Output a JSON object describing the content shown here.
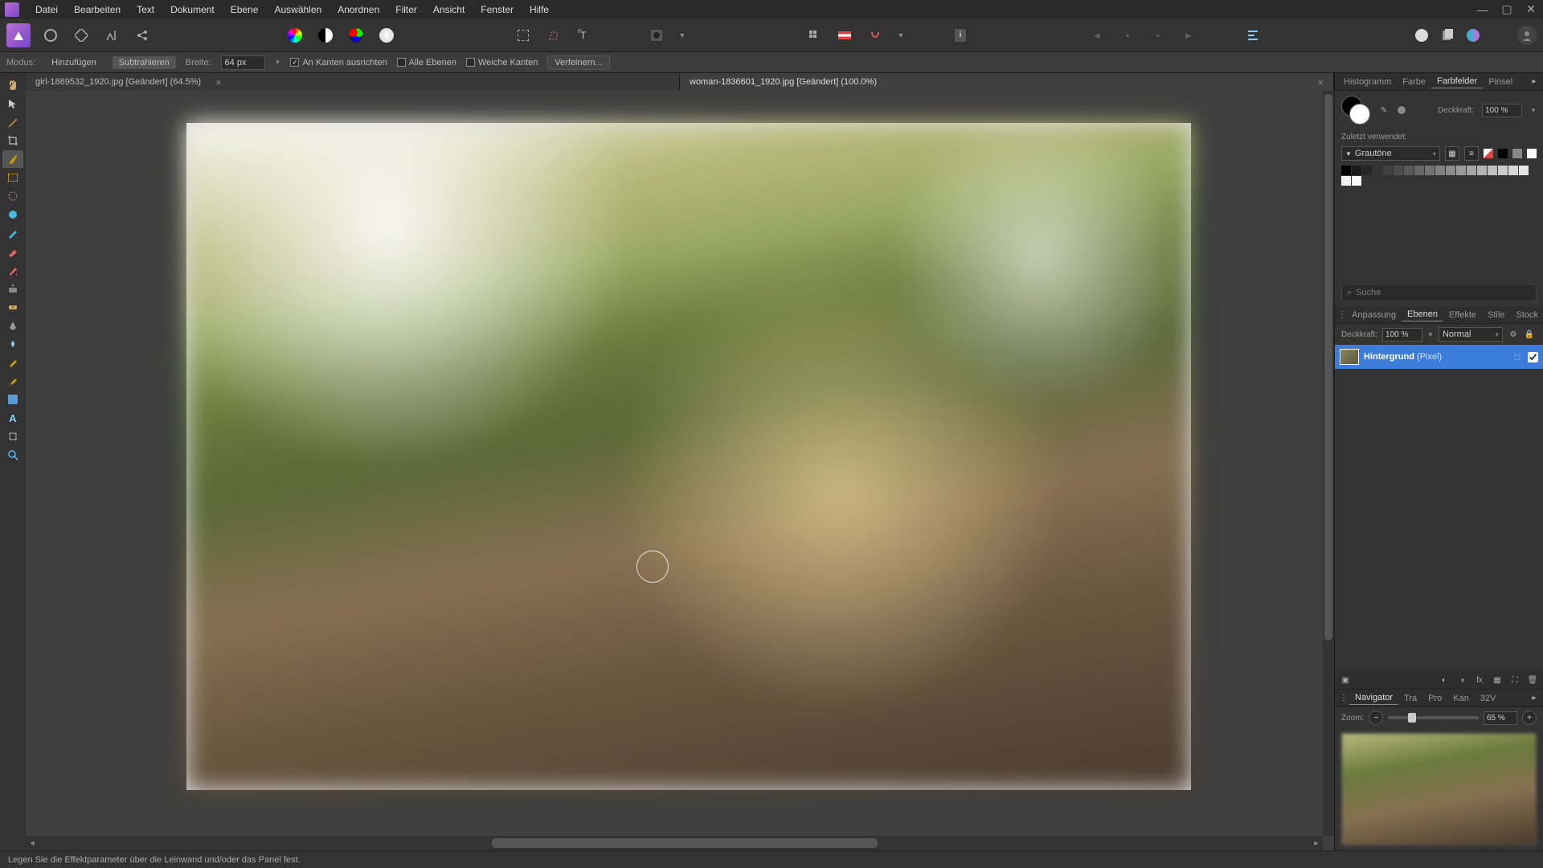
{
  "menu": {
    "items": [
      "Datei",
      "Bearbeiten",
      "Text",
      "Dokument",
      "Ebene",
      "Auswählen",
      "Anordnen",
      "Filter",
      "Ansicht",
      "Fenster",
      "Hilfe"
    ]
  },
  "window": {
    "min": "—",
    "max": "▢",
    "close": "✕"
  },
  "context": {
    "modus_label": "Modus:",
    "add": "Hinzufügen",
    "sub": "Subtrahieren",
    "width_label": "Breite:",
    "width_value": "64 px",
    "snap": "An Kanten ausrichten",
    "all_layers": "Alle Ebenen",
    "soft": "Weiche Kanten",
    "refine": "Verfeinern..."
  },
  "tabs": [
    {
      "title": "girl-1869532_1920.jpg [Geändert] (64.5%)",
      "active": false
    },
    {
      "title": "woman-1836601_1920.jpg [Geändert] (100.0%)",
      "active": true
    }
  ],
  "right": {
    "top_tabs": [
      "Histogramm",
      "Farbe",
      "Farbfelder",
      "Pinsel"
    ],
    "top_active": "Farbfelder",
    "opacity_label": "Deckkraft:",
    "opacity_value": "100 %",
    "recent_label": "Zuletzt verwendet:",
    "palette": "Grautöne",
    "search_placeholder": "Suche",
    "mid_tabs": [
      "Anpassung",
      "Ebenen",
      "Effekte",
      "Stile",
      "Stock"
    ],
    "mid_active": "Ebenen",
    "layer_opacity_label": "Deckkraft:",
    "layer_opacity_value": "100 %",
    "blend_mode": "Normal",
    "layer_name": "Hintergrund",
    "layer_type": "(Pixel)",
    "nav_tabs": [
      "Navigator",
      "Tra",
      "Pro",
      "Kan",
      "32V"
    ],
    "nav_active": "Navigator",
    "zoom_label": "Zoom:",
    "zoom_value": "65 %"
  },
  "status": "Legen Sie die Effektparameter über die Leinwand und/oder das Panel fest.",
  "grays": [
    "#000000",
    "#1a1a1a",
    "#262626",
    "#333333",
    "#404040",
    "#4d4d4d",
    "#595959",
    "#666666",
    "#737373",
    "#808080",
    "#8c8c8c",
    "#999999",
    "#a6a6a6",
    "#b3b3b3",
    "#bfbfbf",
    "#cccccc",
    "#d9d9d9",
    "#e6e6e6",
    "#f2f2f2",
    "#ffffff"
  ]
}
